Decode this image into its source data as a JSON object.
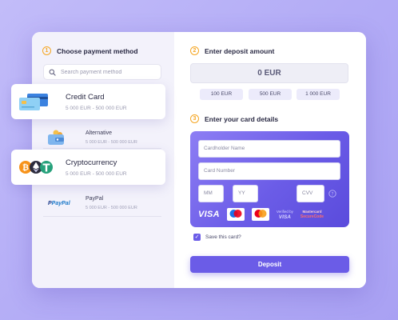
{
  "steps": {
    "one": {
      "num": "1",
      "title": "Choose payment method"
    },
    "two": {
      "num": "2",
      "title": "Enter deposit amount"
    },
    "three": {
      "num": "3",
      "title": "Enter your card details"
    }
  },
  "search": {
    "placeholder": "Search payment method",
    "icon": "search-icon"
  },
  "methods": [
    {
      "name": "Credit Card",
      "range": "5 000 EUR - 500 000 EUR",
      "icon": "credit-card-icon",
      "selected": true
    },
    {
      "name": "Alternative",
      "range": "5 000 EUR - 500 000 EUR",
      "icon": "wallet-icon",
      "selected": false
    },
    {
      "name": "Cryptocurrency",
      "range": "5 000 EUR - 500 000 EUR",
      "icon": "crypto-coins-icon",
      "selected": true
    },
    {
      "name": "PayPal",
      "range": "5 000 EUR - 500 000 EUR",
      "icon": "paypal-logo",
      "logo_text": "PayPal",
      "selected": false
    }
  ],
  "amount": {
    "value": "0 EUR",
    "chips": [
      "100 EUR",
      "500 EUR",
      "1 000 EUR"
    ]
  },
  "card_form": {
    "holder_placeholder": "Cardholder Name",
    "number_placeholder": "Card Number",
    "mm_placeholder": "MM",
    "yy_placeholder": "YY",
    "cvv_placeholder": "CVV",
    "brands": {
      "visa": "VISA",
      "verified_top": "Verified by",
      "verified_bottom": "VISA",
      "securecode_top": "Mastercard",
      "securecode_bottom": "SecureCode"
    }
  },
  "save_card": {
    "label": "Save this card?",
    "checked": true
  },
  "deposit": {
    "label": "Deposit"
  },
  "colors": {
    "accent": "#6b5ce7",
    "step": "#f5a623",
    "background": "#b3acf6"
  }
}
